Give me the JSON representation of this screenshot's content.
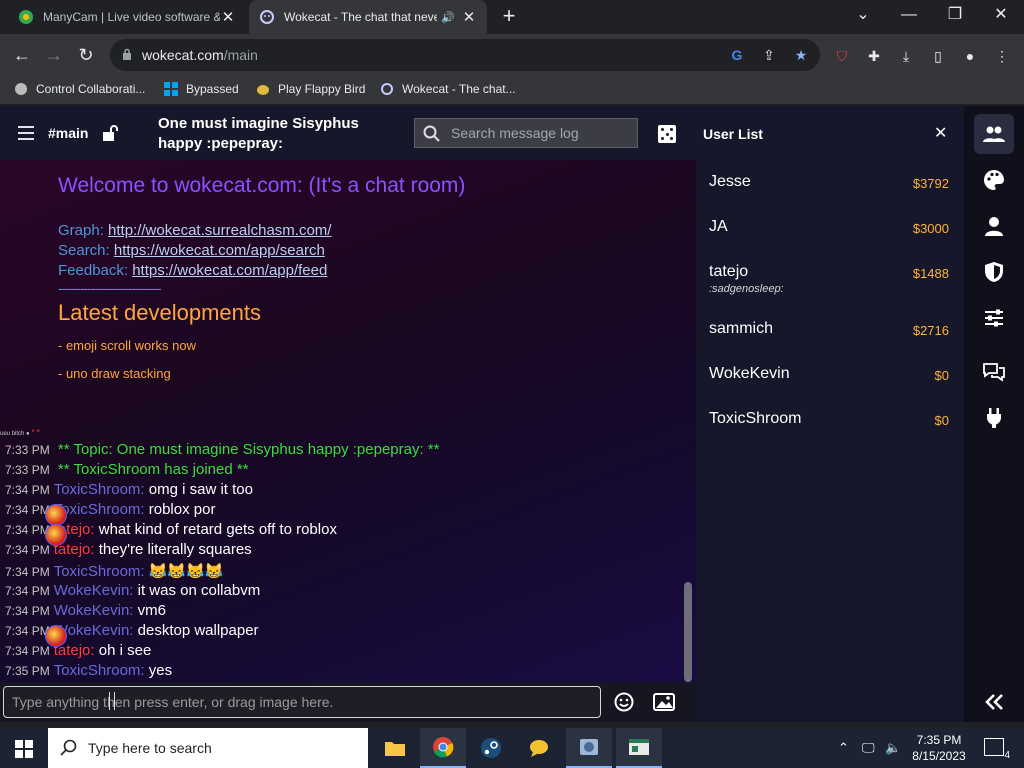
{
  "browser": {
    "tabs": [
      {
        "title": "ManyCam | Live video software &",
        "active": false
      },
      {
        "title": "Wokecat - The chat that never",
        "active": true
      }
    ],
    "url_host": "wokecat.com",
    "url_path": "/main",
    "bookmarks": [
      "Control Collaborati...",
      "Bypassed",
      "Play Flappy Bird",
      "Wokecat - The chat..."
    ]
  },
  "header": {
    "channel": "#main",
    "topic": "One must imagine Sisyphus happy :pepepray:",
    "search_placeholder": "Search message log"
  },
  "motd": {
    "welcome": "Welcome to wokecat.com: (It's a chat room)",
    "links": [
      {
        "label": "Graph:",
        "url": "http://wokecat.surrealchasm.com/"
      },
      {
        "label": "Search:",
        "url": "https://wokecat.com/app/search"
      },
      {
        "label": "Feedback:",
        "url": "https://wokecat.com/app/feed"
      }
    ],
    "divider": "----------------------------",
    "latest_title": "Latest developments",
    "items": [
      "- emoji scroll works now",
      "- uno draw stacking"
    ]
  },
  "tiny_user": "ueu bitch",
  "messages": [
    {
      "time": "7:33 PM",
      "text": "** Topic: One must imagine Sisyphus happy :pepepray: **",
      "type": "system"
    },
    {
      "time": "7:33 PM",
      "text": "** ToxicShroom has joined **",
      "type": "system"
    },
    {
      "time": "7:34 PM",
      "nick": "ToxicShroom:",
      "text": "omg i saw it too",
      "type": "user",
      "color": "blue"
    },
    {
      "time": "7:34 PM",
      "nick": "ToxicShroom:",
      "text": "roblox por",
      "type": "user",
      "color": "blue"
    },
    {
      "time": "7:34 PM",
      "nick": "tatejo:",
      "text": "what kind of retard gets off to roblox",
      "type": "user",
      "color": "red"
    },
    {
      "time": "7:34 PM",
      "nick": "tatejo:",
      "text": "they're literally squares",
      "type": "user",
      "color": "red"
    },
    {
      "time": "7:34 PM",
      "nick": "ToxicShroom:",
      "text": "😹😹😹😹",
      "type": "user",
      "color": "blue"
    },
    {
      "time": "7:34 PM",
      "nick": "WokeKevin:",
      "text": "it was on collabvm",
      "type": "user",
      "color": "blue"
    },
    {
      "time": "7:34 PM",
      "nick": "WokeKevin:",
      "text": "vm6",
      "type": "user",
      "color": "blue"
    },
    {
      "time": "7:34 PM",
      "nick": "WokeKevin:",
      "text": "desktop wallpaper",
      "type": "user",
      "color": "blue"
    },
    {
      "time": "7:34 PM",
      "nick": "tatejo:",
      "text": "oh i see",
      "type": "user",
      "color": "red"
    },
    {
      "time": "7:35 PM",
      "nick": "ToxicShroom:",
      "text": "yes",
      "type": "user",
      "color": "blue"
    }
  ],
  "composer": {
    "placeholder": "Type anything then press enter, or drag image here."
  },
  "userlist": {
    "title": "User List",
    "users": [
      {
        "name": "Jesse",
        "balance": "$3792",
        "status": ""
      },
      {
        "name": "JA",
        "balance": "$3000",
        "status": ""
      },
      {
        "name": "tatejo",
        "balance": "$1488",
        "status": ":sadgenosleep:"
      },
      {
        "name": "sammich",
        "balance": "$2716",
        "status": ""
      },
      {
        "name": "WokeKevin",
        "balance": "$0",
        "status": ""
      },
      {
        "name": "ToxicShroom",
        "balance": "$0",
        "status": ""
      }
    ]
  },
  "taskbar": {
    "search_placeholder": "Type here to search",
    "time": "7:35 PM",
    "date": "8/15/2023",
    "notifications": "4"
  }
}
